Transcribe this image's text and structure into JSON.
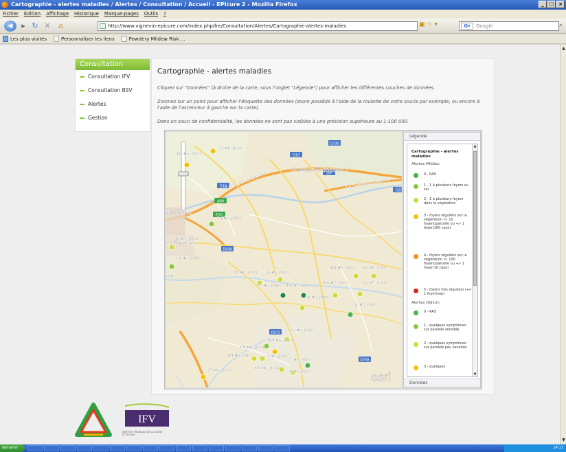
{
  "window": {
    "title": "Cartographie - alertes maladies / Alertes / Consultation / Accueil - EPIcure 2 - Mozilla Firefox",
    "controls": [
      "_",
      "□",
      "×"
    ]
  },
  "menubar": [
    "Fichier",
    "Édition",
    "Affichage",
    "Historique",
    "Marque-pages",
    "Outils",
    "?"
  ],
  "toolbar": {
    "url": "http://www.vignevin-epicure.com/index.php/fre/Consultation/Alertes/Cartographie-alertes-maladies",
    "search_placeholder": "Google"
  },
  "bookmarks": [
    "Les plus visités",
    "Personnaliser les liens",
    "Powdery Mildew Risk ..."
  ],
  "sidebar": {
    "title": "Consultation",
    "items": [
      "Consultation IFV",
      "Consultation BSV",
      "Alertes",
      "Gestion"
    ]
  },
  "page": {
    "title": "Cartographie - alertes maladies",
    "para1": "Cliquez sur \"Données\" (à droite de la carte, sous l'onglet \"Légende\") pour afficher les différentes couches de données.",
    "para2": "Zoomez sur un point pour afficher l'étiquette des données (zoom possible à l'aide de la roulette de votre souris par exemple, ou encore à l'aide de l'ascenceur à gauche sur la carte).",
    "para3": "Dans un souci de confidentialité, les données ne sont pas visibles à une précision supérieure au 1:100 000."
  },
  "map": {
    "places": [
      "Montpon-Ménesterol",
      "La Transeuropéenne",
      "La Transeuropéenne",
      "int-Loubès",
      "es-Bordeaux",
      "non",
      "autoroute des"
    ],
    "road_labels": [
      "D730",
      "D10",
      "D6",
      "D18",
      "A89",
      "E70",
      "D936",
      "D20",
      "D708",
      "D671"
    ],
    "watermark": "esri",
    "points": [
      {
        "label": "14/06/2010",
        "color": "#f4c20d"
      },
      {
        "label": "08/06/2010",
        "color": "#f4c20d"
      },
      {
        "label": "14/06/2010",
        "color": "#8cc63f"
      },
      {
        "label": "26/05/2010",
        "color": "#cddc39"
      },
      {
        "label": "14/06/2010",
        "color": "#8cc63f"
      },
      {
        "label": "08/06/2010",
        "color": "#cddc39"
      },
      {
        "label": "26/06/2010",
        "color": "#cddc39"
      },
      {
        "label": "08/06/2010",
        "color": "#cddc39"
      },
      {
        "label": "08/06/2010",
        "color": "#cddc39"
      },
      {
        "label": "07/06/2010",
        "color": "#1e8a3c"
      },
      {
        "label": "08/07/2010",
        "color": "#1e8a3c"
      },
      {
        "label": "08/07/2010",
        "color": "#cddc39"
      },
      {
        "label": "08/07/2010",
        "color": "#cddc39"
      },
      {
        "label": "02/06/2010",
        "color": "#cddc39"
      },
      {
        "label": "31/05/2010",
        "color": "#4caf50"
      },
      {
        "label": "16/06/2010",
        "color": "#cddc39"
      },
      {
        "label": "09/06/2010",
        "color": "#8cc63f"
      },
      {
        "label": "09/06/2010",
        "color": "#cddc39"
      },
      {
        "label": "09/06/2010",
        "color": "#cddc39"
      },
      {
        "label": "14/06/2010",
        "color": "#f4c20d"
      },
      {
        "label": "17/06/2010",
        "color": "#4caf50"
      },
      {
        "label": "15/06/2010",
        "color": "#f4c20d"
      },
      {
        "label": "09/06/2010",
        "color": "#cddc39"
      },
      {
        "label": "18/06/2010",
        "color": "#cddc39"
      }
    ]
  },
  "legend": {
    "tab": "Légende",
    "bottom_tab": "Données",
    "title": "Cartographie - alertes maladies",
    "mildiou_title": "Alertes Mildiou",
    "mildiou": [
      {
        "label": "0 - RAS",
        "color": "#4caf50"
      },
      {
        "label": "1 - 1 à plusieurs foyers au sol",
        "color": "#8cc63f"
      },
      {
        "label": "2 - 1 à plusieurs foyers dans la végétation",
        "color": "#cddc39"
      },
      {
        "label": "3 - foyers réguliers sur la végétation (> 10 foyers/parcelle ou +/- 1 foyer/100 ceps)",
        "color": "#f4c20d"
      },
      {
        "label": "4 - foyers réguliers sur la végétation (> 100 foyers/parcelle ou +/- 1 foyer/10 ceps)",
        "color": "#ff8c1a"
      },
      {
        "label": "5 - foyers très réguliers (+/- 1 foyer/cep)",
        "color": "#e0201e"
      }
    ],
    "oidium_title": "Alertes Oïdium",
    "oidium": [
      {
        "label": "0 - RAS",
        "color": "#4caf50"
      },
      {
        "label": "1 - quelques symptômes sur parcelle sensible",
        "color": "#8cc63f"
      },
      {
        "label": "2 - quelques symptômes sur parcelle peu sensible",
        "color": "#cddc39"
      },
      {
        "label": "3 - quelques",
        "color": "#f4c20d"
      }
    ]
  },
  "footer": {
    "ifv_logo": "IFV",
    "ifv_subtitle": "INSTITUT FRANÇAIS DE LA VIGNE ET DU VIN",
    "other_logo": "EPICURE"
  },
  "taskbar": {
    "start": "démarrer",
    "clock": "14:13"
  }
}
